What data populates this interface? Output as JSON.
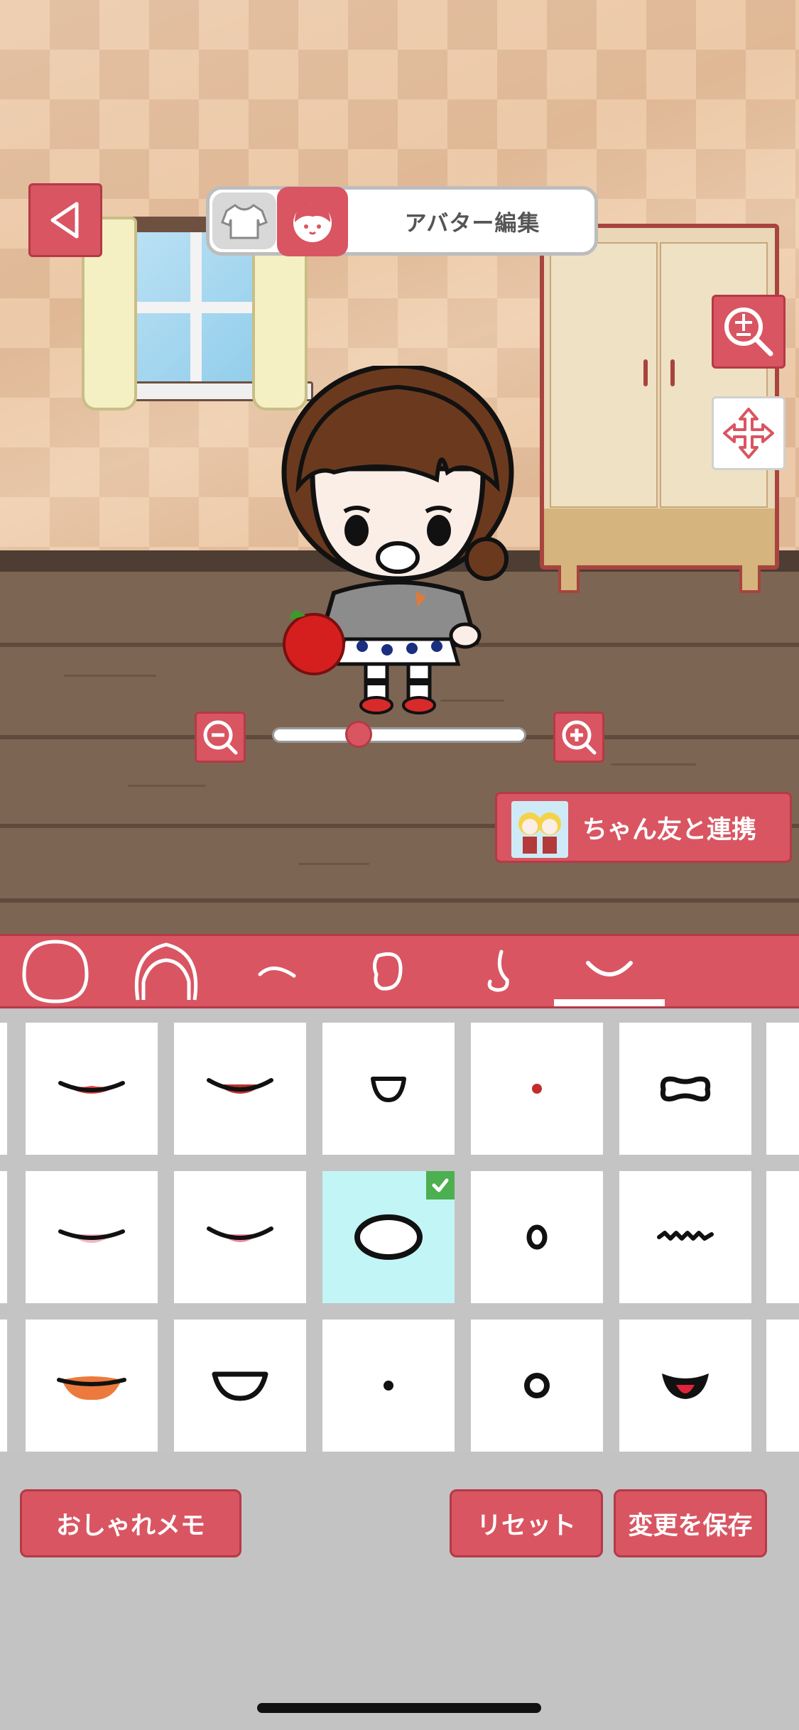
{
  "header": {
    "title": "アバター編集",
    "modes": [
      "clothes",
      "avatar"
    ],
    "active_mode": "avatar"
  },
  "zoom": {
    "level_fraction": 0.32
  },
  "link_button": {
    "label": "ちゃん友と連携"
  },
  "part_tabs": [
    {
      "name": "face-shape",
      "icon": "face-outline-icon"
    },
    {
      "name": "hair",
      "icon": "hair-outline-icon"
    },
    {
      "name": "eyebrows",
      "icon": "eyebrow-icon"
    },
    {
      "name": "ears",
      "icon": "ear-icon"
    },
    {
      "name": "nose",
      "icon": "nose-icon"
    },
    {
      "name": "mouth",
      "icon": "mouth-icon",
      "active": true
    }
  ],
  "mouth_options": {
    "selected_row": 1,
    "selected_col": 2
  },
  "buttons": {
    "memo": "おしゃれメモ",
    "reset": "リセット",
    "save": "変更を保存"
  },
  "colors": {
    "accent": "#d95562",
    "accent_dark": "#b43a47",
    "selected_cell": "#c2f5f6",
    "check": "#4caf50"
  }
}
